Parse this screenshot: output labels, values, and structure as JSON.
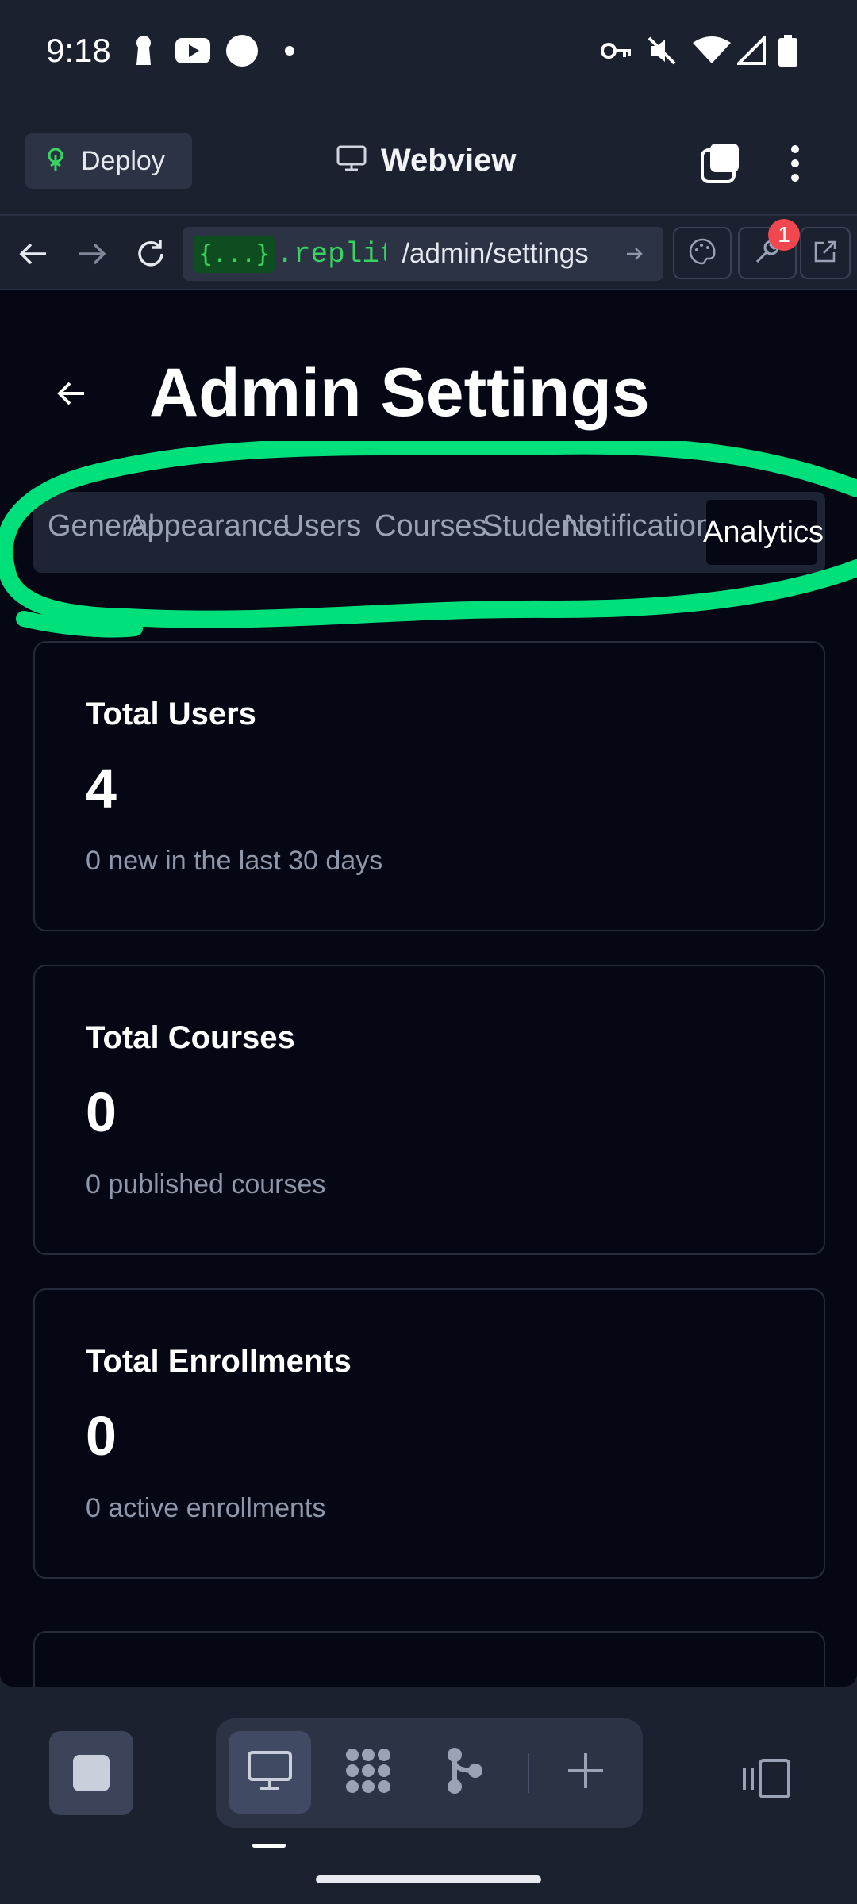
{
  "status_bar": {
    "time": "9:18"
  },
  "header": {
    "deploy_label": "Deploy",
    "webview_label": "Webview"
  },
  "url_bar": {
    "brace": "{...}",
    "domain": ".replit.c",
    "path": "/admin/settings",
    "notification_count": "1"
  },
  "page": {
    "title": "Admin Settings",
    "tabs": [
      {
        "label": "General"
      },
      {
        "label": "Appearance"
      },
      {
        "label": "Users"
      },
      {
        "label": "Courses"
      },
      {
        "label": "Students"
      },
      {
        "label": "Notifications"
      },
      {
        "label": "Analytics",
        "active": true
      }
    ],
    "cards": [
      {
        "title": "Total Users",
        "value": "4",
        "subtitle": "0 new in the last 30 days"
      },
      {
        "title": "Total Courses",
        "value": "0",
        "subtitle": "0 published courses"
      },
      {
        "title": "Total Enrollments",
        "value": "0",
        "subtitle": "0 active enrollments"
      }
    ]
  },
  "colors": {
    "accent_green": "#37d45f",
    "highlight_stroke": "#00e07a",
    "badge_red": "#f2474f",
    "page_bg": "#050814",
    "chrome_bg": "#1c2130"
  }
}
